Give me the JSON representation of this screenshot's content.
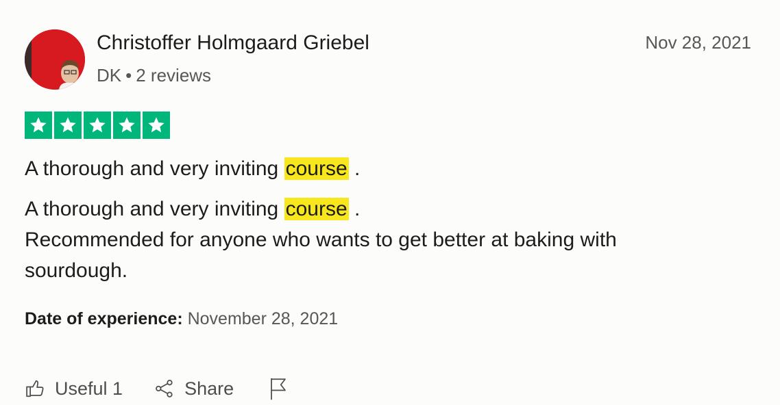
{
  "review": {
    "reviewer": {
      "name": "Christoffer Holmgaard Griebel",
      "country": "DK",
      "separator": "•",
      "reviews_count": "2 reviews"
    },
    "date": "Nov 28, 2021",
    "rating": {
      "stars": 5,
      "max": 5,
      "color": "#00b67a"
    },
    "title": {
      "before": "A thorough and very inviting ",
      "highlight": "course",
      "after": " ."
    },
    "body": {
      "line1_before": "A thorough and very inviting ",
      "line1_highlight": "course",
      "line1_after": " .",
      "line2": "Recommended for anyone who wants to get better at baking with sourdough."
    },
    "experience": {
      "label": "Date of experience:",
      "value": "November 28, 2021"
    },
    "actions": {
      "useful_label": "Useful 1",
      "useful_icon": "thumbs-up-icon",
      "share_label": "Share",
      "share_icon": "share-icon",
      "report_icon": "flag-icon"
    },
    "highlight_color": "#f9e71e"
  }
}
